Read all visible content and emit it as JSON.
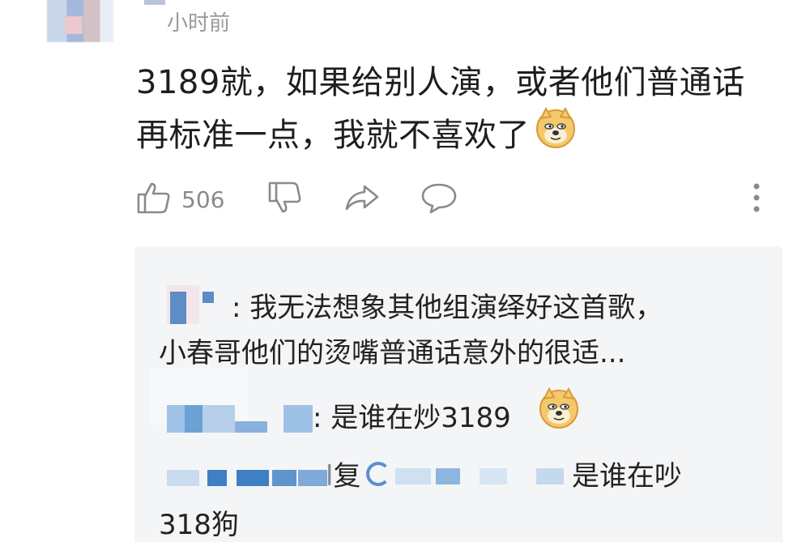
{
  "comment": {
    "time": "小时前",
    "text_line1": "3189就，如果给别人演，或者他们普通话",
    "text_line2": "再标准一点，我就不喜欢了",
    "like_count": "506"
  },
  "replies": {
    "reply1_line1": ": 我无法想象其他组演绎好这首歌，",
    "reply1_line2": "小春哥他们的烫嘴普通话意外的很适...",
    "reply2_text": ": 是谁在炒3189",
    "reply3_mid": "复",
    "reply3_tail": "是谁在吵",
    "reply3_line2": "318狗"
  },
  "icons": {
    "like": "thumb-up-icon",
    "dislike": "thumb-down-icon",
    "share": "share-arrow-icon",
    "comment": "comment-bubble-icon",
    "more": "more-vertical-icon",
    "emoji": "doge-emoji-icon"
  },
  "colors": {
    "background": "#ffffff",
    "reply_bg": "#f4f5f7",
    "text": "#1e1e1e",
    "muted": "#9a9a9a",
    "icon": "#8a8a8a"
  }
}
